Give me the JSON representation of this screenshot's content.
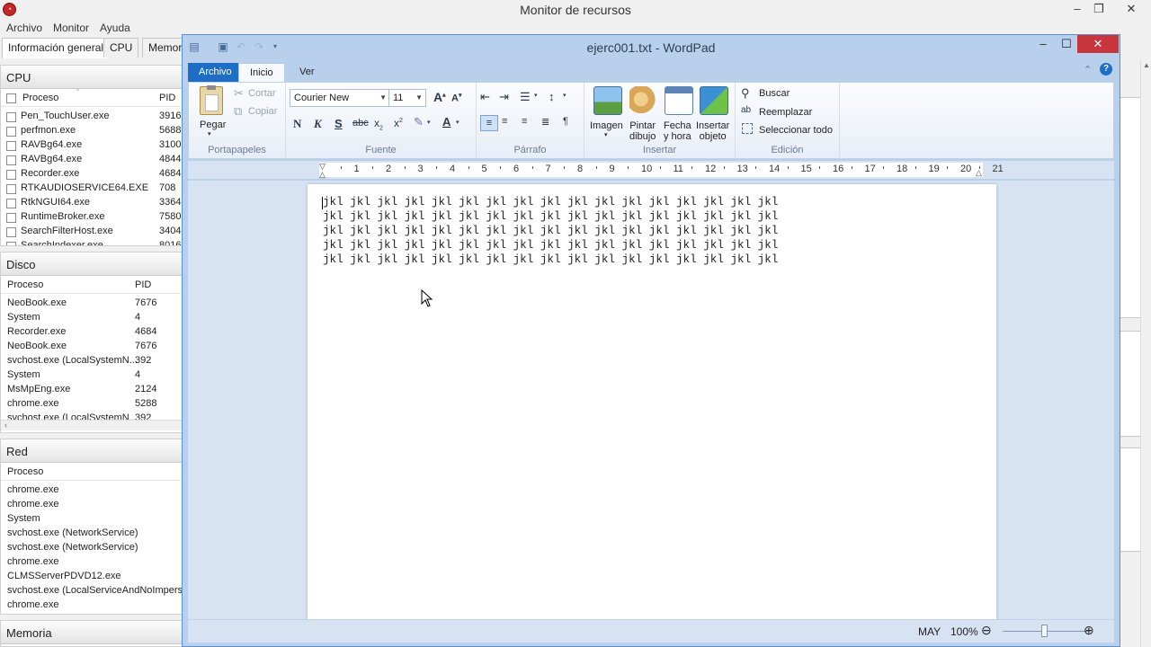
{
  "resmon": {
    "title": "Monitor de recursos",
    "menu": [
      "Archivo",
      "Monitor",
      "Ayuda"
    ],
    "tabs": [
      "Información general",
      "CPU",
      "Memor"
    ],
    "cpu": {
      "header": "CPU",
      "col_proceso": "Proceso",
      "col_pid": "PID",
      "rows": [
        {
          "name": "Pen_TouchUser.exe",
          "pid": "3916"
        },
        {
          "name": "perfmon.exe",
          "pid": "5688"
        },
        {
          "name": "RAVBg64.exe",
          "pid": "3100"
        },
        {
          "name": "RAVBg64.exe",
          "pid": "4844"
        },
        {
          "name": "Recorder.exe",
          "pid": "4684"
        },
        {
          "name": "RTKAUDIOSERVICE64.EXE",
          "pid": "708"
        },
        {
          "name": "RtkNGUI64.exe",
          "pid": "3364"
        },
        {
          "name": "RuntimeBroker.exe",
          "pid": "7580"
        },
        {
          "name": "SearchFilterHost.exe",
          "pid": "3404"
        },
        {
          "name": "SearchIndexer.exe",
          "pid": "8016"
        }
      ]
    },
    "disco": {
      "header": "Disco",
      "col_proceso": "Proceso",
      "col_pid": "PID",
      "rows": [
        {
          "name": "NeoBook.exe",
          "pid": "7676"
        },
        {
          "name": "System",
          "pid": "4"
        },
        {
          "name": "Recorder.exe",
          "pid": "4684"
        },
        {
          "name": "NeoBook.exe",
          "pid": "7676"
        },
        {
          "name": "svchost.exe (LocalSystemN...",
          "pid": "392"
        },
        {
          "name": "System",
          "pid": "4"
        },
        {
          "name": "MsMpEng.exe",
          "pid": "2124"
        },
        {
          "name": "chrome.exe",
          "pid": "5288"
        },
        {
          "name": "svchost.exe (LocalSystemN...",
          "pid": "392"
        }
      ]
    },
    "red": {
      "header": "Red",
      "col_proceso": "Proceso",
      "rows": [
        "chrome.exe",
        "chrome.exe",
        "System",
        "svchost.exe (NetworkService)",
        "svchost.exe (NetworkService)",
        "chrome.exe",
        "CLMSServerPDVD12.exe",
        "svchost.exe (LocalServiceAndNoImperson",
        "chrome.exe"
      ]
    },
    "memoria": {
      "header": "Memoria"
    }
  },
  "wordpad": {
    "title": "ejerc001.txt - WordPad",
    "tabs": {
      "file": "Archivo",
      "home": "Inicio",
      "view": "Ver"
    },
    "clipboard": {
      "paste": "Pegar",
      "cut": "Cortar",
      "copy": "Copiar",
      "group": "Portapapeles"
    },
    "font": {
      "family": "Courier New",
      "size": "11",
      "group": "Fuente"
    },
    "paragraph": {
      "group": "Párrafo"
    },
    "insert": {
      "image": "Imagen",
      "paint_1": "Pintar",
      "paint_2": "dibujo",
      "date_1": "Fecha",
      "date_2": "y hora",
      "object_1": "Insertar",
      "object_2": "objeto",
      "group": "Insertar"
    },
    "editing": {
      "find": "Buscar",
      "replace": "Reemplazar",
      "select_all": "Seleccionar todo",
      "group": "Edición"
    },
    "ruler": {
      "numbers": [
        "1",
        "2",
        "3",
        "4",
        "5",
        "6",
        "7",
        "8",
        "9",
        "10",
        "11",
        "12",
        "13",
        "14",
        "15",
        "16",
        "17",
        "18",
        "19",
        "20",
        "21"
      ]
    },
    "document": {
      "lines": [
        "jkl jkl jkl jkl jkl jkl jkl jkl jkl jkl jkl jkl jkl jkl jkl jkl jkl",
        "jkl jkl jkl jkl jkl jkl jkl jkl jkl jkl jkl jkl jkl jkl jkl jkl jkl",
        "jkl jkl jkl jkl jkl jkl jkl jkl jkl jkl jkl jkl jkl jkl jkl jkl jkl",
        "jkl jkl jkl jkl jkl jkl jkl jkl jkl jkl jkl jkl jkl jkl jkl jkl jkl",
        "jkl jkl jkl jkl jkl jkl jkl jkl jkl jkl jkl jkl jkl jkl jkl jkl jkl"
      ]
    },
    "status": {
      "caps": "MAY",
      "zoom": "100%",
      "zoom_level": 0.5
    }
  },
  "colors": {
    "accent": "#1e6ec8",
    "close": "#c7363c",
    "frame": "#b8d0ec"
  }
}
